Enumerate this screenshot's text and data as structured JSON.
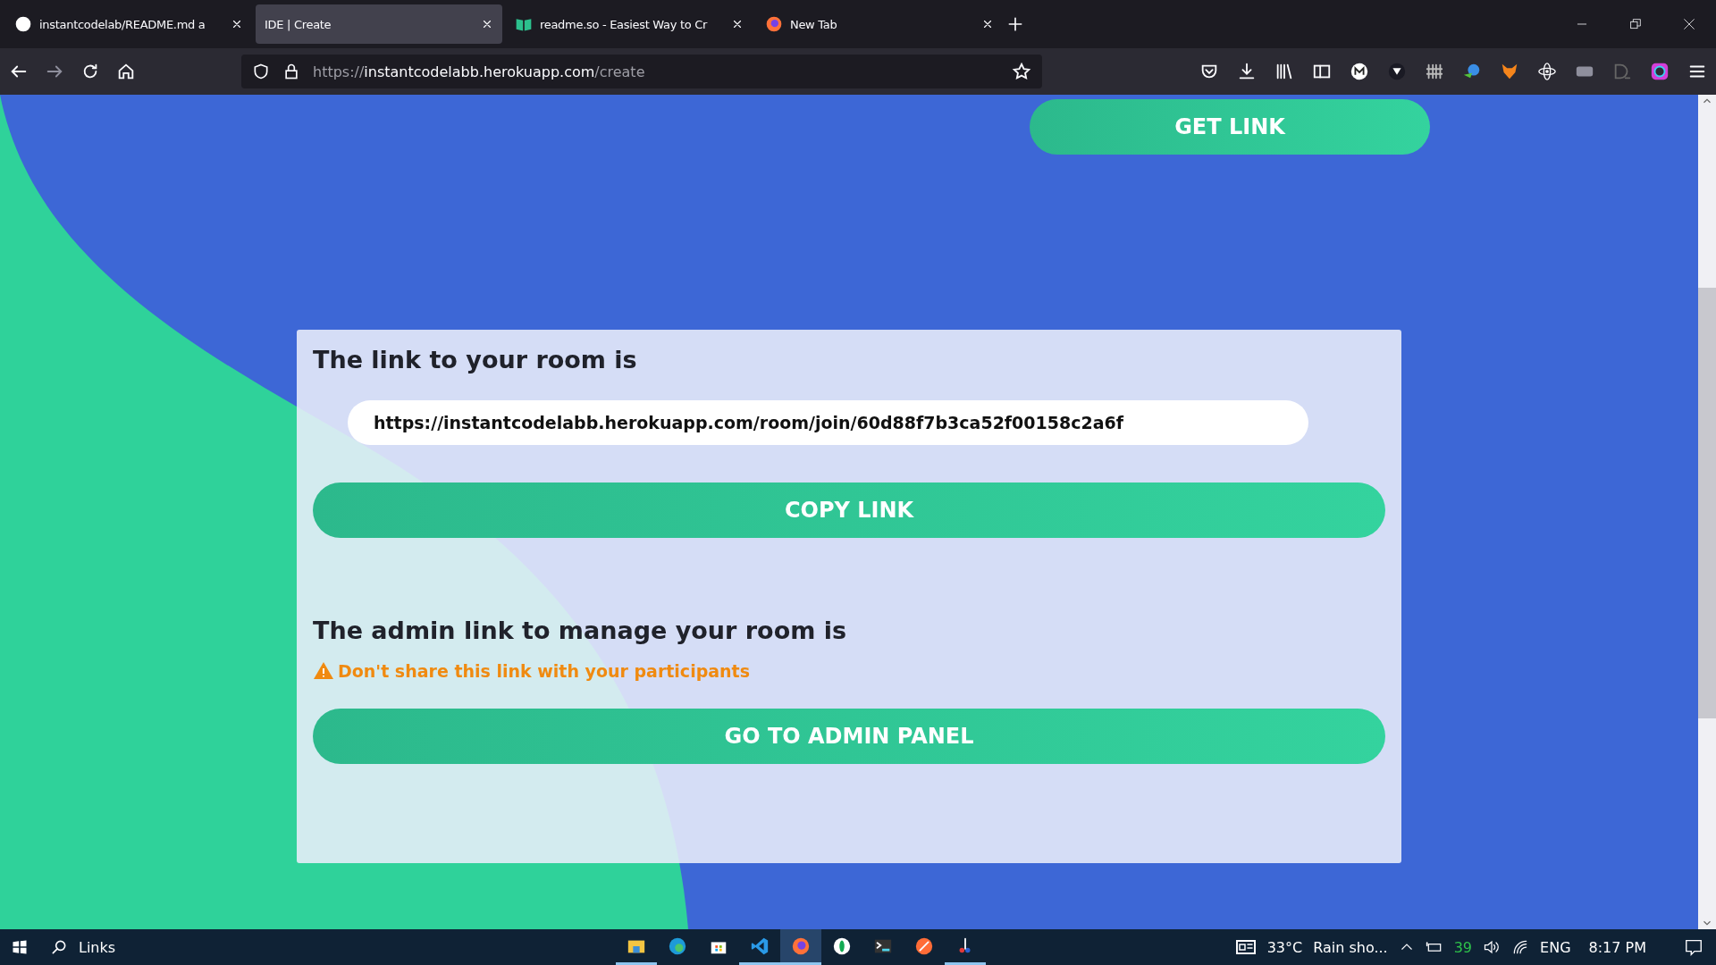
{
  "browser": {
    "tabs": [
      {
        "title": "instantcodelab/README.md a",
        "kind": "github",
        "selected": false
      },
      {
        "title": "IDE | Create",
        "kind": "plain",
        "selected": true
      },
      {
        "title": "readme.so - Easiest Way to Cr",
        "kind": "book",
        "selected": false
      },
      {
        "title": "New Tab",
        "kind": "firefox",
        "selected": false
      }
    ],
    "url": {
      "scheme": "https://",
      "host": "instantcodelabb.herokuapp.com",
      "path": "/create"
    }
  },
  "page": {
    "get_link_button": "GET LINK",
    "card": {
      "title": "The link to your room is",
      "room_link": "https://instantcodelabb.herokuapp.com/room/join/60d88f7b3ca52f00158c2a6f",
      "copy_button": "COPY LINK",
      "admin_title": "The admin link to manage your room is",
      "warning": "Don't share this link with your participants",
      "admin_button": "GO TO ADMIN PANEL"
    }
  },
  "taskbar": {
    "search_label": "Links",
    "apps": [
      {
        "kind": "folder",
        "open": true,
        "selected": false
      },
      {
        "kind": "edge",
        "open": false,
        "selected": false
      },
      {
        "kind": "store",
        "open": false,
        "selected": false
      },
      {
        "kind": "vscode",
        "open": true,
        "selected": false
      },
      {
        "kind": "firefox",
        "open": true,
        "selected": true
      },
      {
        "kind": "mongo",
        "open": false,
        "selected": false
      },
      {
        "kind": "terminal",
        "open": false,
        "selected": false
      },
      {
        "kind": "postman",
        "open": false,
        "selected": false
      },
      {
        "kind": "snip",
        "open": true,
        "selected": false
      }
    ],
    "temperature": "33°C",
    "weather": "Rain sho...",
    "battery": "39",
    "language": "ENG",
    "time": "8:17 PM"
  }
}
